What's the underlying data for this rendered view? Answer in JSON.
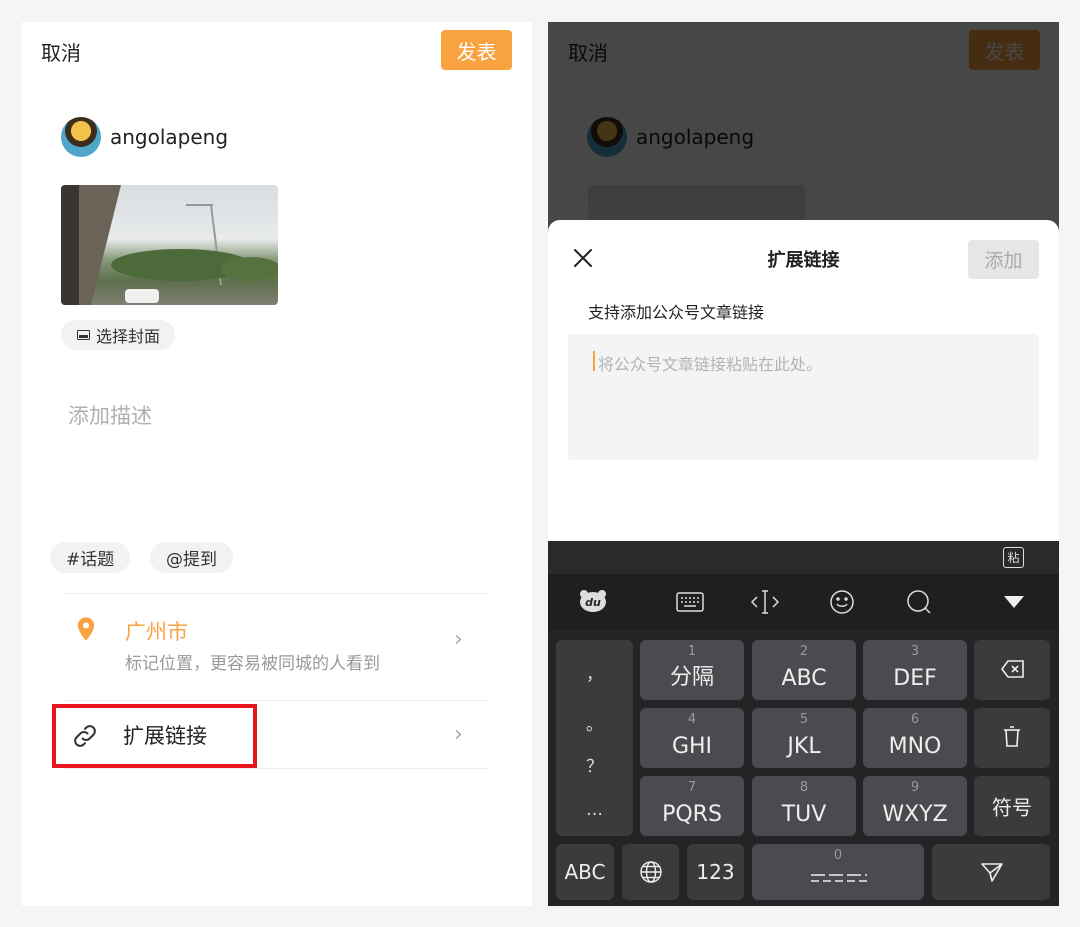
{
  "left": {
    "cancel": "取消",
    "publish": "发表",
    "username": "angolapeng",
    "cover_button": "选择封面",
    "description_placeholder": "添加描述",
    "tags": [
      "#话题",
      "@提到"
    ],
    "location": {
      "title": "广州市",
      "subtitle": "标记位置，更容易被同城的人看到"
    },
    "extend_link": "扩展链接"
  },
  "right": {
    "cancel": "取消",
    "publish": "发表",
    "username": "angolapeng",
    "sheet": {
      "title": "扩展链接",
      "add_button": "添加",
      "hint": "支持添加公众号文章链接",
      "placeholder": "将公众号文章链接粘贴在此处。"
    },
    "keyboard": {
      "side_keys": [
        "，",
        "。",
        "？",
        "…"
      ],
      "keys": [
        {
          "num": "1",
          "label": "分隔"
        },
        {
          "num": "2",
          "label": "ABC"
        },
        {
          "num": "3",
          "label": "DEF"
        },
        {
          "num": "4",
          "label": "GHI"
        },
        {
          "num": "5",
          "label": "JKL"
        },
        {
          "num": "6",
          "label": "MNO"
        },
        {
          "num": "7",
          "label": "PQRS"
        },
        {
          "num": "8",
          "label": "TUV"
        },
        {
          "num": "9",
          "label": "WXYZ"
        }
      ],
      "symbol_key": "符号",
      "abc_key": "ABC",
      "num_key": "123",
      "space_num": "0",
      "paste_glyph": "粘"
    }
  },
  "colors": {
    "accent": "#f9a340",
    "highlight_box": "#e8141e"
  }
}
